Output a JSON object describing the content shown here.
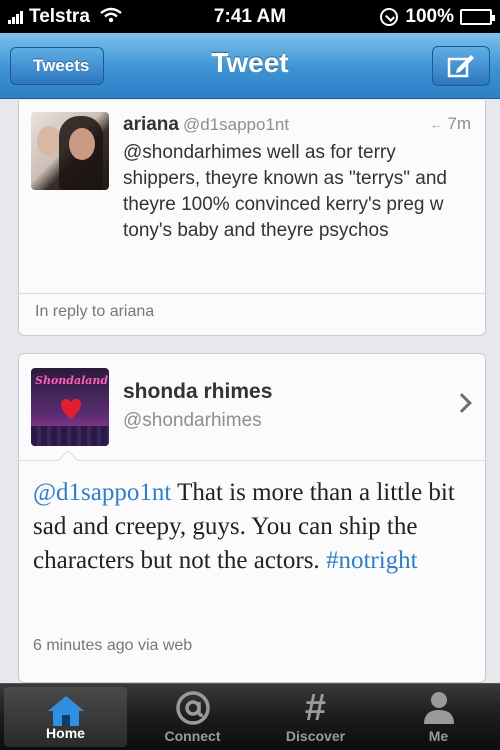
{
  "status_bar": {
    "carrier": "Telstra",
    "time": "7:41 AM",
    "battery": "100%",
    "battery_level": 1.0
  },
  "nav": {
    "back_label": "Tweets",
    "title": "Tweet",
    "compose_icon": "compose-icon"
  },
  "reply_tweet": {
    "name": "ariana",
    "handle": "@d1sappo1nt",
    "time": "7m",
    "text": "@shondarhimes well as for terry shippers, theyre known as \"terrys\" and theyre 100% convinced kerry's preg w tony's baby and theyre psychos",
    "context": "In reply to ariana"
  },
  "main_tweet": {
    "name": "shonda rhimes",
    "handle": "@shondarhimes",
    "mention": "@d1sappo1nt",
    "text_body": " That is more than a little bit sad and creepy, guys.  You can ship the characters but not the actors. ",
    "hashtag": "#notright",
    "meta": "6 minutes ago via web"
  },
  "tabs": [
    {
      "label": "Home",
      "icon": "home-icon",
      "active": true
    },
    {
      "label": "Connect",
      "icon": "at-icon",
      "active": false
    },
    {
      "label": "Discover",
      "icon": "hash-icon",
      "active": false
    },
    {
      "label": "Me",
      "icon": "person-icon",
      "active": false
    }
  ]
}
